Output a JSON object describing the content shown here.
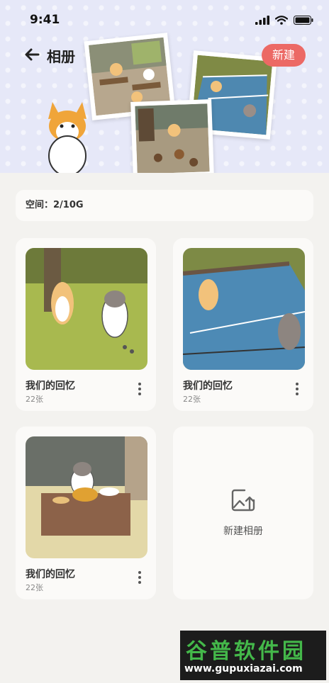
{
  "status_bar": {
    "time": "9:41"
  },
  "header": {
    "title": "相册",
    "new_button": "新建"
  },
  "storage": {
    "label": "空间：",
    "value": "2/10G"
  },
  "albums": [
    {
      "name": "我们的回忆",
      "count": "22张"
    },
    {
      "name": "我们的回忆",
      "count": "22张"
    },
    {
      "name": "我们的回忆",
      "count": "22张"
    }
  ],
  "new_album": {
    "label": "新建相册"
  },
  "watermark": {
    "title": "谷普软件园",
    "url": "www.gupuxiazai.com"
  },
  "colors": {
    "accent": "#ec6965",
    "header_bg": "#e6e8f8",
    "page_bg": "#f3f2ef"
  }
}
